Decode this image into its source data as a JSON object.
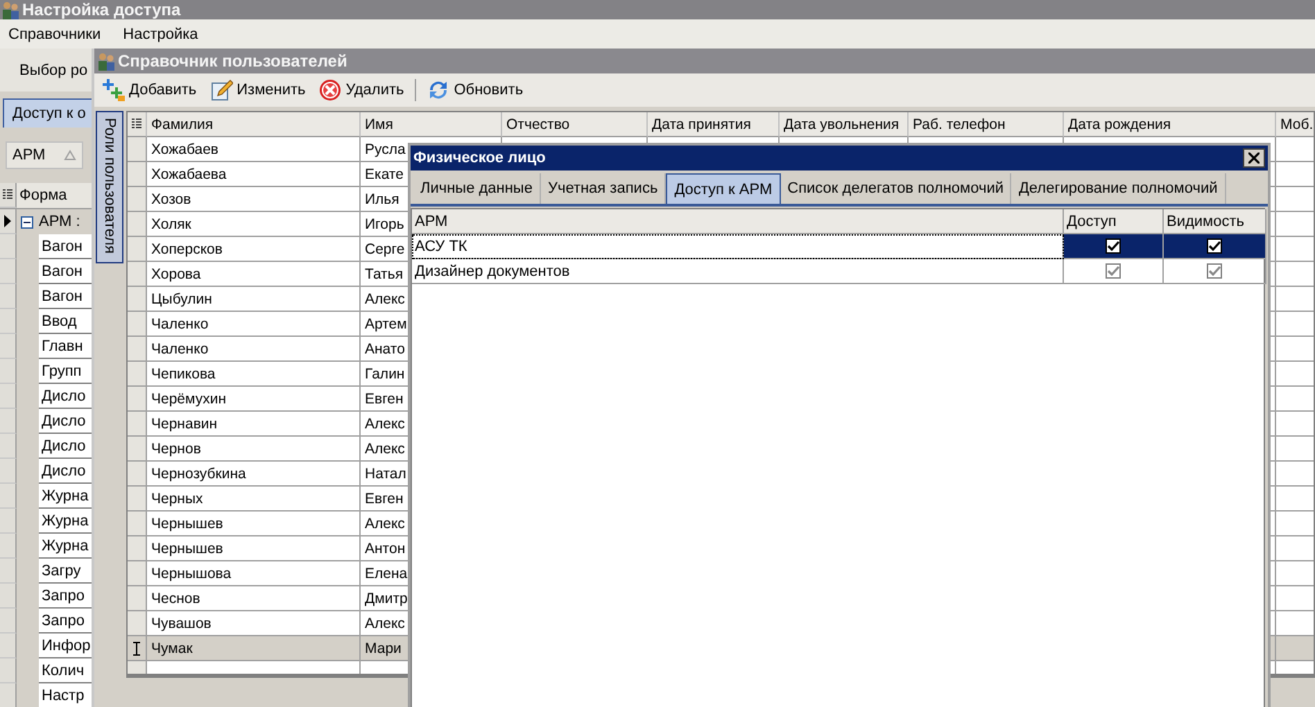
{
  "main_window": {
    "title": "Настройка доступа",
    "menu": [
      "Справочники",
      "Настройка"
    ],
    "toolbar_button": "Выбор ро",
    "tab": {
      "label": "Доступ к о",
      "selected": true
    },
    "sort_field": "АРМ",
    "grid": {
      "column": "Форма",
      "group": {
        "label": "АРМ :",
        "expanded": true,
        "selected": true,
        "rows": [
          "Вагон",
          "Вагон",
          "Вагон",
          "Ввод",
          "Главн",
          "Групп",
          "Дисло",
          "Дисло",
          "Дисло",
          "Дисло",
          "Журна",
          "Журна",
          "Журна",
          "Загру",
          "Запро",
          "Запро",
          "Инфор",
          "Колич",
          "Настр"
        ]
      }
    }
  },
  "users_window": {
    "title": "Справочник пользователей",
    "toolbar": [
      {
        "label": "Добавить",
        "kind": "add"
      },
      {
        "label": "Изменить",
        "kind": "edit"
      },
      {
        "label": "Удалить",
        "kind": "delete"
      },
      {
        "label": "Обновить",
        "kind": "refresh"
      }
    ],
    "side_tab": "Роли пользователя",
    "columns": [
      "Фамилия",
      "Имя",
      "Отчество",
      "Дата принятия",
      "Дата увольнения",
      "Раб. телефон",
      "Дата рождения",
      "Моб."
    ],
    "rows": [
      {
        "surname": "Хожабаев",
        "name": "Русла",
        "selected": false
      },
      {
        "surname": "Хожабаева",
        "name": "Екате",
        "selected": false
      },
      {
        "surname": "Хозов",
        "name": "Илья",
        "selected": false
      },
      {
        "surname": "Холяк",
        "name": "Игорь",
        "selected": false
      },
      {
        "surname": "Хоперсков",
        "name": "Серге",
        "selected": false
      },
      {
        "surname": "Хорова",
        "name": "Татья",
        "selected": false
      },
      {
        "surname": "Цыбулин",
        "name": "Алекс",
        "selected": false
      },
      {
        "surname": "Чаленко",
        "name": "Артем",
        "selected": false
      },
      {
        "surname": "Чаленко",
        "name": "Анато",
        "selected": false
      },
      {
        "surname": "Чепикова",
        "name": "Галин",
        "selected": false
      },
      {
        "surname": "Черёмухин",
        "name": "Евген",
        "selected": false
      },
      {
        "surname": "Чернавин",
        "name": "Алекс",
        "selected": false
      },
      {
        "surname": "Чернов",
        "name": "Алекс",
        "selected": false
      },
      {
        "surname": "Чернозубкина",
        "name": "Натал",
        "selected": false
      },
      {
        "surname": "Черных",
        "name": "Евген",
        "selected": false
      },
      {
        "surname": "Чернышев",
        "name": "Алекс",
        "selected": false
      },
      {
        "surname": "Чернышев",
        "name": "Антон",
        "selected": false
      },
      {
        "surname": "Чернышова",
        "name": "Елена",
        "selected": false
      },
      {
        "surname": "Чеснов",
        "name": "Дмитр",
        "selected": false
      },
      {
        "surname": "Чувашов",
        "name": "Алекс",
        "selected": false
      },
      {
        "surname": "Чумак",
        "name": "Мари",
        "selected": true
      }
    ]
  },
  "dialog": {
    "title": "Физическое лицо",
    "tabs": [
      {
        "label": "Личные данные",
        "selected": false
      },
      {
        "label": "Учетная запись",
        "selected": false
      },
      {
        "label": "Доступ к АРМ",
        "selected": true
      },
      {
        "label": "Список делегатов полномочий",
        "selected": false
      },
      {
        "label": "Делегирование полномочий",
        "selected": false
      }
    ],
    "columns": [
      "АРМ",
      "Доступ",
      "Видимость"
    ],
    "rows": [
      {
        "name": "АСУ ТК",
        "access": true,
        "visibility": true,
        "selected": true
      },
      {
        "name": "Дизайнер документов",
        "access": true,
        "visibility": true,
        "selected": false
      }
    ]
  }
}
